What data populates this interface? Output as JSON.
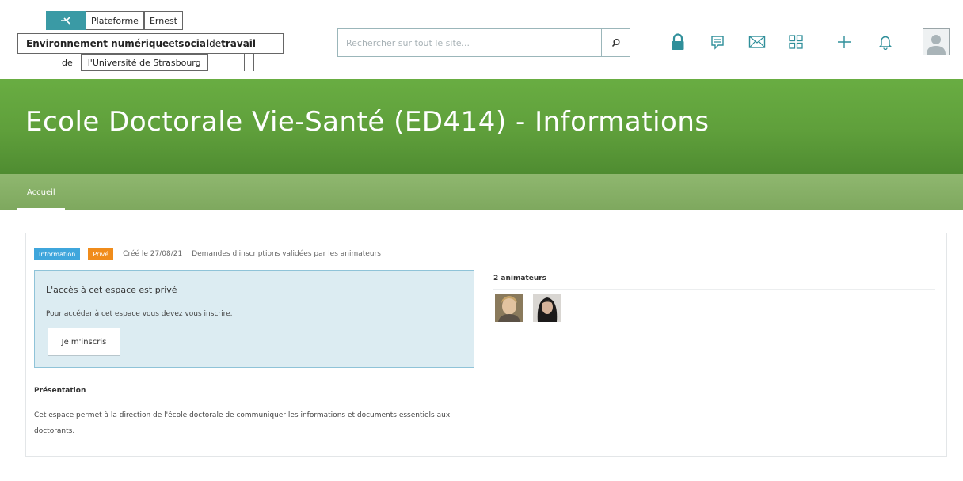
{
  "header": {
    "logo": {
      "line1_a": "Plateforme",
      "line1_b": "Ernest",
      "line2_a": "Environnement numérique",
      "line2_b": " et ",
      "line2_c": "social",
      "line2_d": " de ",
      "line2_e": "travail",
      "line3_de": "de",
      "line3_univ": "l'Université de Strasbourg"
    },
    "search": {
      "placeholder": "Rechercher sur tout le site..."
    },
    "icons": [
      "lock-icon",
      "chat-icon",
      "mail-icon",
      "apps-grid-icon",
      "plus-icon",
      "bell-icon",
      "user-avatar-icon"
    ]
  },
  "banner": {
    "title": "Ecole Doctorale Vie-Santé (ED414) - Informations"
  },
  "nav": {
    "tabs": [
      {
        "label": "Accueil",
        "active": true
      }
    ]
  },
  "space": {
    "badge_type": "Information",
    "badge_visibility": "Privé",
    "created": "Créé le 27/08/21",
    "subscription_note": "Demandes d'inscriptions validées par les animateurs",
    "access": {
      "title": "L'accès à cet espace est privé",
      "text": "Pour accéder à cet espace vous devez vous inscrire.",
      "button": "Je m'inscris"
    },
    "animators": {
      "title": "2 animateurs",
      "count": 2
    },
    "presentation": {
      "title": "Présentation",
      "text": "Cet espace permet à la direction de l'école doctorale de communiquer les informations et documents essentiels aux doctorants."
    }
  },
  "colors": {
    "banner_green": "#5f9f3b",
    "nav_green": "#86af66",
    "badge_info": "#3fa6dc",
    "badge_private": "#f08c1b",
    "access_bg": "#dcecf2",
    "icon_teal": "#2f8f9a",
    "logo_teal": "#3a9aa5"
  }
}
